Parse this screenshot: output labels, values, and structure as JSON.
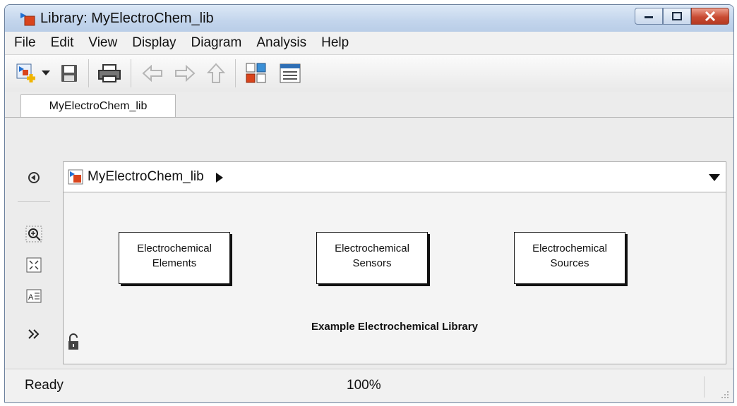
{
  "window": {
    "title": "Library: MyElectroChem_lib"
  },
  "menu": {
    "items": [
      "File",
      "Edit",
      "View",
      "Display",
      "Diagram",
      "Analysis",
      "Help"
    ]
  },
  "toolbar": {
    "icons": [
      "new-model-icon",
      "dropdown-arrow-icon",
      "save-icon",
      "print-icon",
      "back-icon",
      "forward-icon",
      "up-icon",
      "model-browser-icon",
      "library-browser-icon"
    ]
  },
  "tabs": [
    {
      "label": "MyElectroChem_lib"
    }
  ],
  "address": {
    "path": "MyElectroChem_lib"
  },
  "canvas": {
    "blocks": [
      {
        "line1": "Electrochemical",
        "line2": "Elements"
      },
      {
        "line1": "Electrochemical",
        "line2": "Sensors"
      },
      {
        "line1": "Electrochemical",
        "line2": "Sources"
      }
    ],
    "library_title": "Example Electrochemical Library"
  },
  "status": {
    "text": "Ready",
    "zoom": "100%"
  },
  "colors": {
    "title_gradient_top": "#dce8f6",
    "close_button": "#c94b33",
    "block_border": "#111111"
  }
}
